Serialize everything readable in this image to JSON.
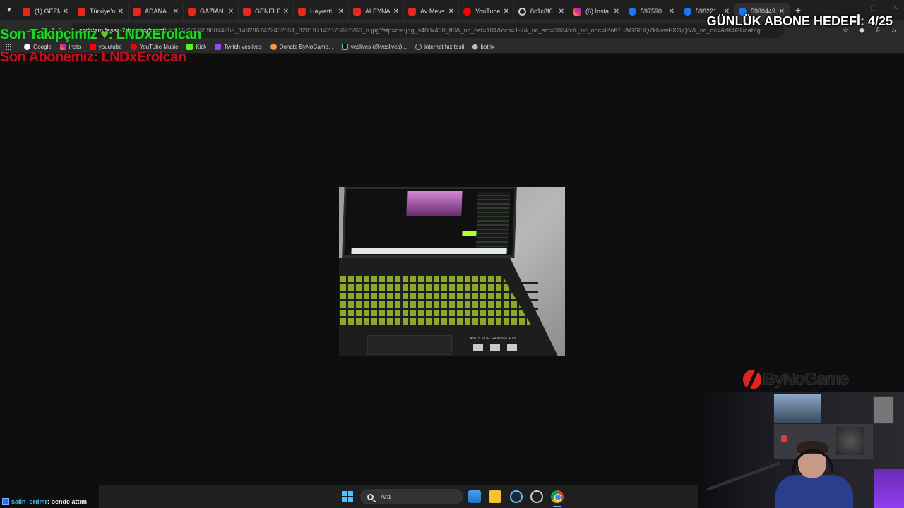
{
  "browser": {
    "tabs": [
      {
        "title": "(1) GEZM",
        "icon": "youtube-icon",
        "active": false
      },
      {
        "title": "Türkiye'n",
        "icon": "youtube-icon",
        "active": false
      },
      {
        "title": "ADANA",
        "icon": "youtube-icon",
        "active": false
      },
      {
        "title": "GAZİAN",
        "icon": "youtube-icon",
        "active": false
      },
      {
        "title": "GENELEV",
        "icon": "youtube-icon",
        "active": false
      },
      {
        "title": "Hayretti",
        "icon": "youtube-icon",
        "active": false
      },
      {
        "title": "ALEYNA",
        "icon": "youtube-icon",
        "active": false
      },
      {
        "title": "Av Mevs",
        "icon": "youtube-icon",
        "active": false
      },
      {
        "title": "YouTube",
        "icon": "youtube-music-icon",
        "active": false
      },
      {
        "title": "8c1c8f6",
        "icon": "globe-icon",
        "active": false
      },
      {
        "title": "(6) Insta",
        "icon": "instagram-icon",
        "active": false
      },
      {
        "title": "597590",
        "icon": "facebook-icon",
        "active": false
      },
      {
        "title": "598221",
        "icon": "facebook-icon",
        "active": false
      },
      {
        "title": "5980449",
        "icon": "facebook-icon",
        "active": true
      }
    ],
    "new_tab": "+",
    "address": {
      "host": "scontent.fass1-2.fna.fbcdn.net",
      "path": "/v/t1.15752-9/598044959_1492967422482851_828197142375697760_n.jpg?stp=dst-jpg_s480x480_tt6&_nc_cat=104&ccb=1-7&_nc_sid=0024fc&_nc_ohc=lPofRHAGSEIQ7kNvwFXGjQV&_nc_oc=Adk4GUcatZg..."
    },
    "bookmarks": [
      {
        "label": "Google",
        "icon": "google-icon"
      },
      {
        "label": "insta",
        "icon": "instagram-icon"
      },
      {
        "label": "youutube",
        "icon": "youtube-icon"
      },
      {
        "label": "YouTube Music",
        "icon": "youtube-music-icon"
      },
      {
        "label": "Kick",
        "icon": "kick-icon"
      },
      {
        "label": "Twitch veslives",
        "icon": "twitch-icon"
      },
      {
        "label": "Donate ByNoGame...",
        "icon": "donate-icon"
      },
      {
        "label": "veslives (@veslives)...",
        "icon": "tiktok-icon"
      },
      {
        "label": "internet hız testi",
        "icon": "speedtest-icon"
      },
      {
        "label": "botrix",
        "icon": "botrix-icon"
      }
    ]
  },
  "overlay": {
    "last_follower": "Son Takipçimiz",
    "heart": "♥",
    "follower_name": ": LNDxErolcan",
    "last_subscriber": "Son Abonemiz: LNDxErolcan",
    "sub_goal": "GÜNLÜK ABONE HEDEFİ: 4/25",
    "sponsor_logo": "ByNoGame"
  },
  "photo": {
    "brand_text": "ASUS TUF GAMING F15"
  },
  "chat": {
    "user": "salih_erdmr",
    "message": ": bende attım"
  },
  "taskbar": {
    "search_placeholder": "Ara",
    "apps": [
      "photos-icon",
      "file-explorer-icon",
      "steam-icon",
      "extension-icon",
      "chrome-icon"
    ],
    "accent": "#4cc2ff"
  },
  "colors": {
    "follower_text": "#25d42a",
    "subscriber_text": "#c1121f",
    "goal_text": "#ffffff",
    "chat_user": "#3fc3ee"
  }
}
